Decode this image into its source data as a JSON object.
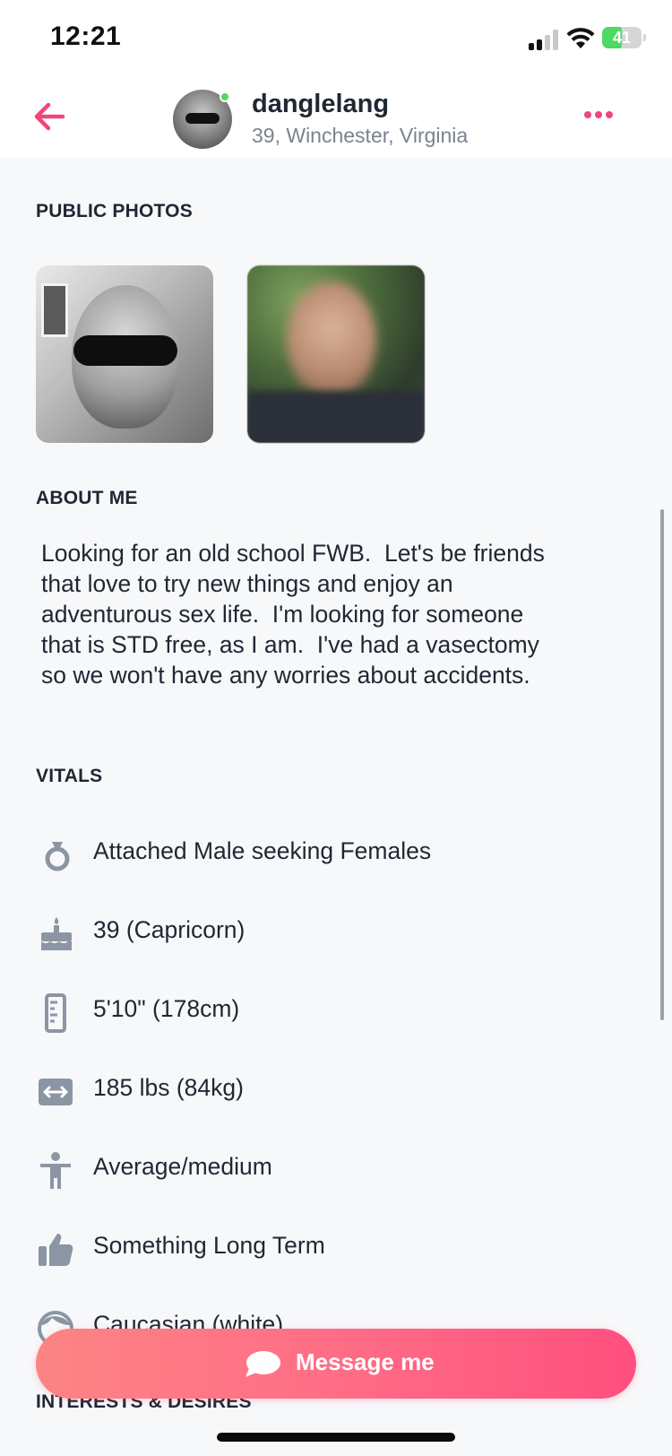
{
  "status_bar": {
    "time": "12:21",
    "battery_percent": "41",
    "battery_level": 0.41,
    "charging": true
  },
  "header": {
    "username": "danglelang",
    "subtitle": "39, Winchester, Virginia",
    "online": true,
    "accent_color": "#f0477a"
  },
  "sections": {
    "public_photos": "PUBLIC PHOTOS",
    "about_me": "ABOUT ME",
    "vitals": "VITALS",
    "interests": "INTERESTS & DESIRES"
  },
  "about": {
    "text": "Looking for an old school FWB.  Let's be friends\nthat love to try new things and enjoy an\nadventurous sex life.  I'm looking for someone\nthat is STD free, as I am.  I've had a vasectomy\nso we won't have any worries about accidents."
  },
  "vitals": [
    {
      "icon": "ring-icon",
      "label": "Attached Male seeking Females"
    },
    {
      "icon": "cake-icon",
      "label": "39 (Capricorn)"
    },
    {
      "icon": "ruler-icon",
      "label": "5'10\" (178cm)"
    },
    {
      "icon": "weight-arrows-icon",
      "label": "185 lbs (84kg)"
    },
    {
      "icon": "body-type-icon",
      "label": "Average/medium"
    },
    {
      "icon": "thumbs-up-icon",
      "label": "Something Long Term"
    },
    {
      "icon": "face-icon",
      "label": "Caucasian (white)"
    }
  ],
  "message_button": {
    "label": "Message me",
    "icon": "chat-bubble-icon"
  }
}
